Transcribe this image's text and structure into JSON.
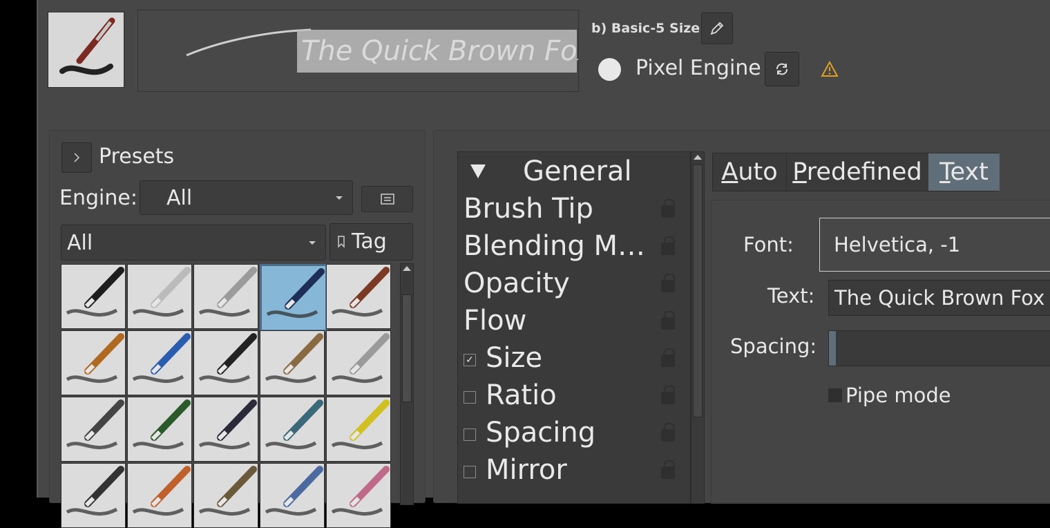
{
  "header": {
    "preset_name": "b) Basic-5 Size",
    "engine_name": "Pixel Engine",
    "preview_text": "The Quick Brown Fox Jumps",
    "edit_icon": "pencil-icon",
    "reload_icon": "reload-icon",
    "warning_icon": "warning-triangle-icon"
  },
  "presets": {
    "title": "Presets",
    "engine_label": "Engine:",
    "engine_value": "All",
    "filter_value": "All",
    "tag_label": "Tag"
  },
  "options": {
    "items": [
      {
        "label": "General",
        "type": "header"
      },
      {
        "label": "Brush Tip",
        "type": "plain"
      },
      {
        "label": "Blending M…",
        "type": "plain"
      },
      {
        "label": "Opacity",
        "type": "plain"
      },
      {
        "label": "Flow",
        "type": "plain"
      },
      {
        "label": "Size",
        "type": "check",
        "checked": true
      },
      {
        "label": "Ratio",
        "type": "check",
        "checked": false
      },
      {
        "label": "Spacing",
        "type": "check",
        "checked": false
      },
      {
        "label": "Mirror",
        "type": "check",
        "checked": false
      }
    ]
  },
  "tip": {
    "tabs": [
      "Auto",
      "Predefined",
      "Text"
    ],
    "active_tab": "Text",
    "font_label": "Font:",
    "font_value": "Helvetica, -1",
    "text_label": "Text:",
    "text_value": "The Quick Brown Fox J",
    "spacing_label": "Spacing:",
    "spacing_fraction": 0.03,
    "pipe_mode_label": "Pipe mode",
    "pipe_mode_checked": false
  },
  "colors": {
    "accent": "#5f6e79",
    "selected_tile": "#86b7d6",
    "warning": "#e0a020"
  }
}
